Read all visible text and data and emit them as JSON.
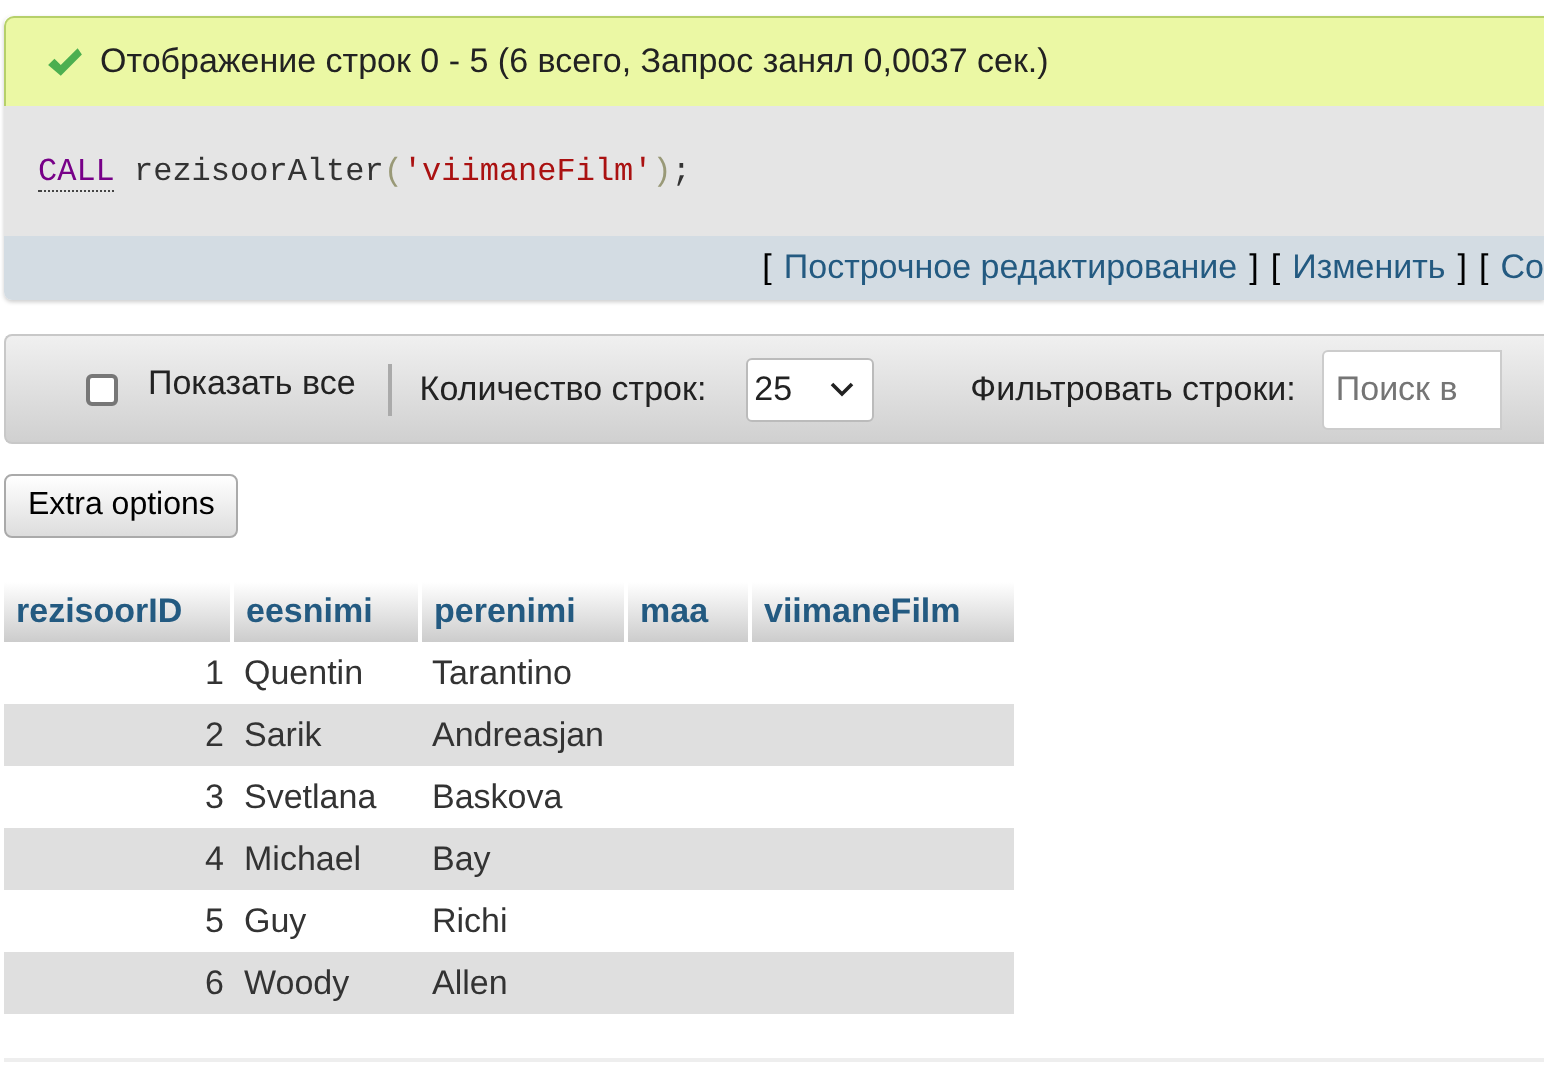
{
  "message": {
    "kind": "success",
    "text": "Отображение строк 0 - 5 (6 всего, Запрос занял 0,0037 сек.)"
  },
  "sql": [
    {
      "kind": "keyword",
      "text": "CALL"
    },
    {
      "kind": "name",
      "text": "rezisoorAlter"
    },
    {
      "kind": "punct",
      "text": "("
    },
    {
      "kind": "string",
      "text": "'viimaneFilm'"
    },
    {
      "kind": "punct",
      "text": ")"
    },
    {
      "kind": "plain",
      "text": ";"
    }
  ],
  "query_links": [
    {
      "kind": "bracket",
      "text": "["
    },
    {
      "kind": "link",
      "text": "Построчное редактирование"
    },
    {
      "kind": "bracket",
      "text": "]"
    },
    {
      "kind": "bracket",
      "text": "["
    },
    {
      "kind": "link",
      "text": "Изменить"
    },
    {
      "kind": "bracket",
      "text": "]"
    },
    {
      "kind": "bracket",
      "text": "["
    },
    {
      "kind": "link",
      "text": "Со"
    }
  ],
  "toolbar": {
    "show_all": {
      "label": "Показать все",
      "checked": false
    },
    "rows_label": "Количество строк:",
    "rows_value": "25",
    "filter_label": "Фильтровать строки:",
    "filter_placeholder": "Поиск в"
  },
  "extra_options": "Extra options",
  "table": {
    "columns": [
      "rezisoorID",
      "eesnimi",
      "perenimi",
      "maa",
      "viimaneFilm"
    ],
    "rows": [
      [
        "1",
        "Quentin",
        "Tarantino"
      ],
      [
        "2",
        "Sarik",
        "Andreasjan"
      ],
      [
        "3",
        "Svetlana",
        "Baskova"
      ],
      [
        "4",
        "Michael",
        "Bay"
      ],
      [
        "5",
        "Guy",
        "Richi"
      ],
      [
        "6",
        "Woody",
        "Allen"
      ]
    ]
  }
}
